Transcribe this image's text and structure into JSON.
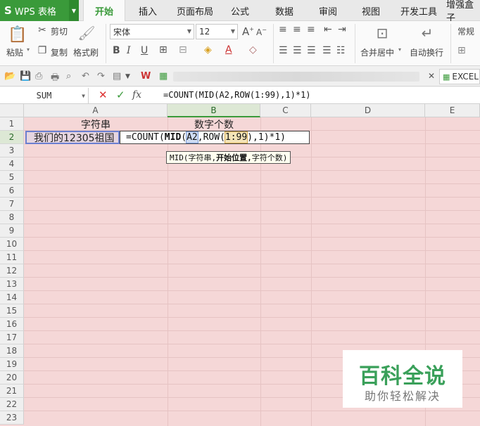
{
  "app": {
    "name": "WPS 表格",
    "logo_glyph": "S"
  },
  "tabs": [
    "开始",
    "插入",
    "页面布局",
    "公式",
    "数据",
    "审阅",
    "视图",
    "开发工具",
    "增强盒子"
  ],
  "active_tab": "开始",
  "ribbon": {
    "paste": "粘贴",
    "cut": "剪切",
    "copy": "复制",
    "format_painter": "格式刷",
    "font_name": "宋体",
    "font_size": "12",
    "merge_center": "合并居中",
    "wrap_text": "自动换行",
    "number_format": "常规"
  },
  "quick_bar": {
    "doc_tab": "EXCEL"
  },
  "formula_bar": {
    "name_box": "SUM",
    "cancel_glyph": "✕",
    "confirm_glyph": "✓",
    "fx_label": "fx",
    "content": "=COUNT(MID(A2,ROW(1:99),1)*1)"
  },
  "columns": [
    "A",
    "B",
    "C",
    "D",
    "E"
  ],
  "rows": [
    "1",
    "2",
    "3",
    "4",
    "5",
    "6",
    "7",
    "8",
    "9",
    "10",
    "11",
    "12",
    "13",
    "14",
    "15",
    "16",
    "17",
    "18",
    "19",
    "20",
    "21",
    "22",
    "23"
  ],
  "cells": {
    "A1": "字符串",
    "B1": "数字个数",
    "A2": "我们的12305祖国"
  },
  "editing": {
    "part1": "=COUNT(",
    "part2": "MID",
    "part3": "(",
    "part4": "A2",
    "part5": ",ROW(",
    "part6": "1:99",
    "part7": "),1)*1)"
  },
  "tooltip": {
    "fn": "MID",
    "open": " (",
    "arg1": "字符串,",
    "arg2": " 开始位置,",
    "arg3": " 字符个数)"
  },
  "watermark": {
    "title": "百科全说",
    "subtitle": "助你轻松解决"
  },
  "colors": {
    "accent": "#3a9a3a",
    "grid_bg": "#f5d7d7",
    "ref_border": "#6b7fd0"
  }
}
